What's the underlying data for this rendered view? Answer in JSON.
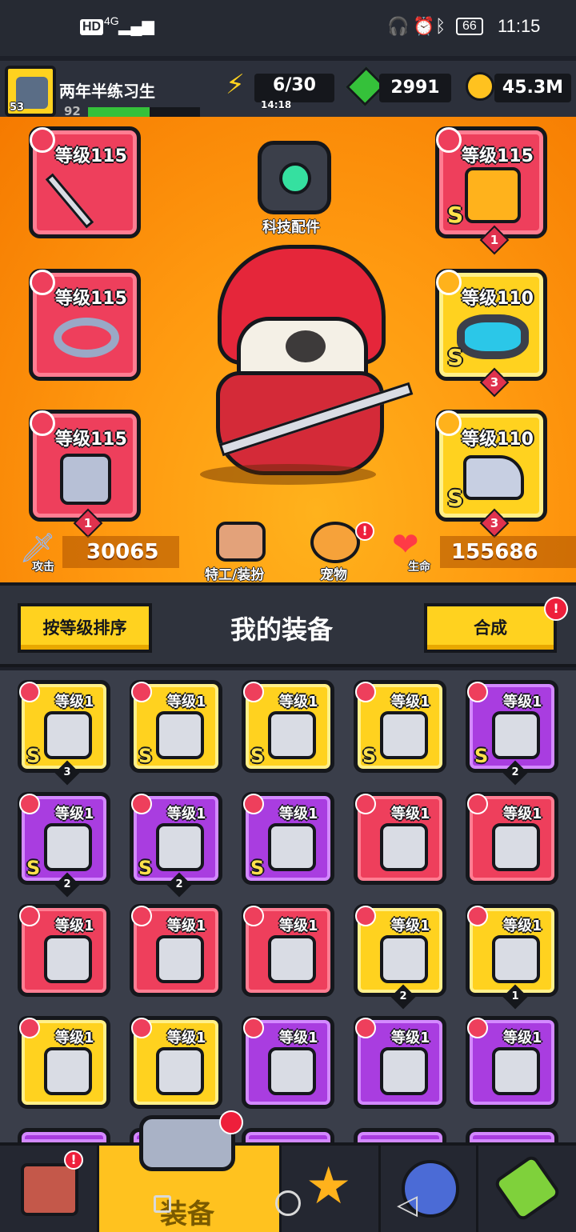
{
  "status_bar": {
    "network": "HD",
    "signal": "4G",
    "battery": "66",
    "time": "11:15"
  },
  "player": {
    "name": "两年半练习生",
    "level": "92",
    "avatar_badge": "53"
  },
  "resources": {
    "energy": "6/30",
    "energy_timer": "14:18",
    "gems": "2991",
    "coins": "45.3M"
  },
  "hero": {
    "tech_label": "科技配件",
    "left_slots": [
      {
        "level": "等级115",
        "type": "weapon-icon",
        "rarity": "red",
        "count": ""
      },
      {
        "level": "等级115",
        "type": "necklace-icon",
        "rarity": "red",
        "count": ""
      },
      {
        "level": "等级115",
        "type": "glove-icon",
        "rarity": "red",
        "count": "1"
      }
    ],
    "right_slots": [
      {
        "level": "等级115",
        "type": "armor-icon",
        "rarity": "red",
        "s": "S",
        "count": "1"
      },
      {
        "level": "等级110",
        "type": "belt-icon",
        "rarity": "yellow",
        "s": "S",
        "count": "3"
      },
      {
        "level": "等级110",
        "type": "boots-icon",
        "rarity": "yellow",
        "s": "S",
        "count": "3"
      }
    ],
    "attack_label": "攻击",
    "attack_value": "30065",
    "agent_label": "特工/装扮",
    "pet_label": "宠物",
    "hp_label": "生命",
    "hp_value": "155686"
  },
  "section": {
    "sort_button": "按等级排序",
    "title": "我的装备",
    "merge_button": "合成"
  },
  "inventory": [
    {
      "level": "等级1",
      "rarity": "y",
      "s": "S",
      "count": "3"
    },
    {
      "level": "等级1",
      "rarity": "y",
      "s": "S",
      "count": ""
    },
    {
      "level": "等级1",
      "rarity": "y",
      "s": "S",
      "count": ""
    },
    {
      "level": "等级1",
      "rarity": "y",
      "s": "S",
      "count": ""
    },
    {
      "level": "等级1",
      "rarity": "p",
      "s": "S",
      "count": "2"
    },
    {
      "level": "等级1",
      "rarity": "p",
      "s": "S",
      "count": "2"
    },
    {
      "level": "等级1",
      "rarity": "p",
      "s": "S",
      "count": "2"
    },
    {
      "level": "等级1",
      "rarity": "p",
      "s": "S",
      "count": ""
    },
    {
      "level": "等级1",
      "rarity": "r",
      "s": "",
      "count": ""
    },
    {
      "level": "等级1",
      "rarity": "r",
      "s": "",
      "count": ""
    },
    {
      "level": "等级1",
      "rarity": "r",
      "s": "",
      "count": ""
    },
    {
      "level": "等级1",
      "rarity": "r",
      "s": "",
      "count": ""
    },
    {
      "level": "等级1",
      "rarity": "r",
      "s": "",
      "count": ""
    },
    {
      "level": "等级1",
      "rarity": "y",
      "s": "",
      "count": "2"
    },
    {
      "level": "等级1",
      "rarity": "y",
      "s": "",
      "count": "1"
    },
    {
      "level": "等级1",
      "rarity": "y",
      "s": "",
      "count": ""
    },
    {
      "level": "等级1",
      "rarity": "y",
      "s": "",
      "count": ""
    },
    {
      "level": "等级1",
      "rarity": "p",
      "s": "",
      "count": ""
    },
    {
      "level": "等级1",
      "rarity": "p",
      "s": "",
      "count": ""
    },
    {
      "level": "等级1",
      "rarity": "p",
      "s": "",
      "count": ""
    }
  ],
  "nav": {
    "equip_label": "装备"
  }
}
